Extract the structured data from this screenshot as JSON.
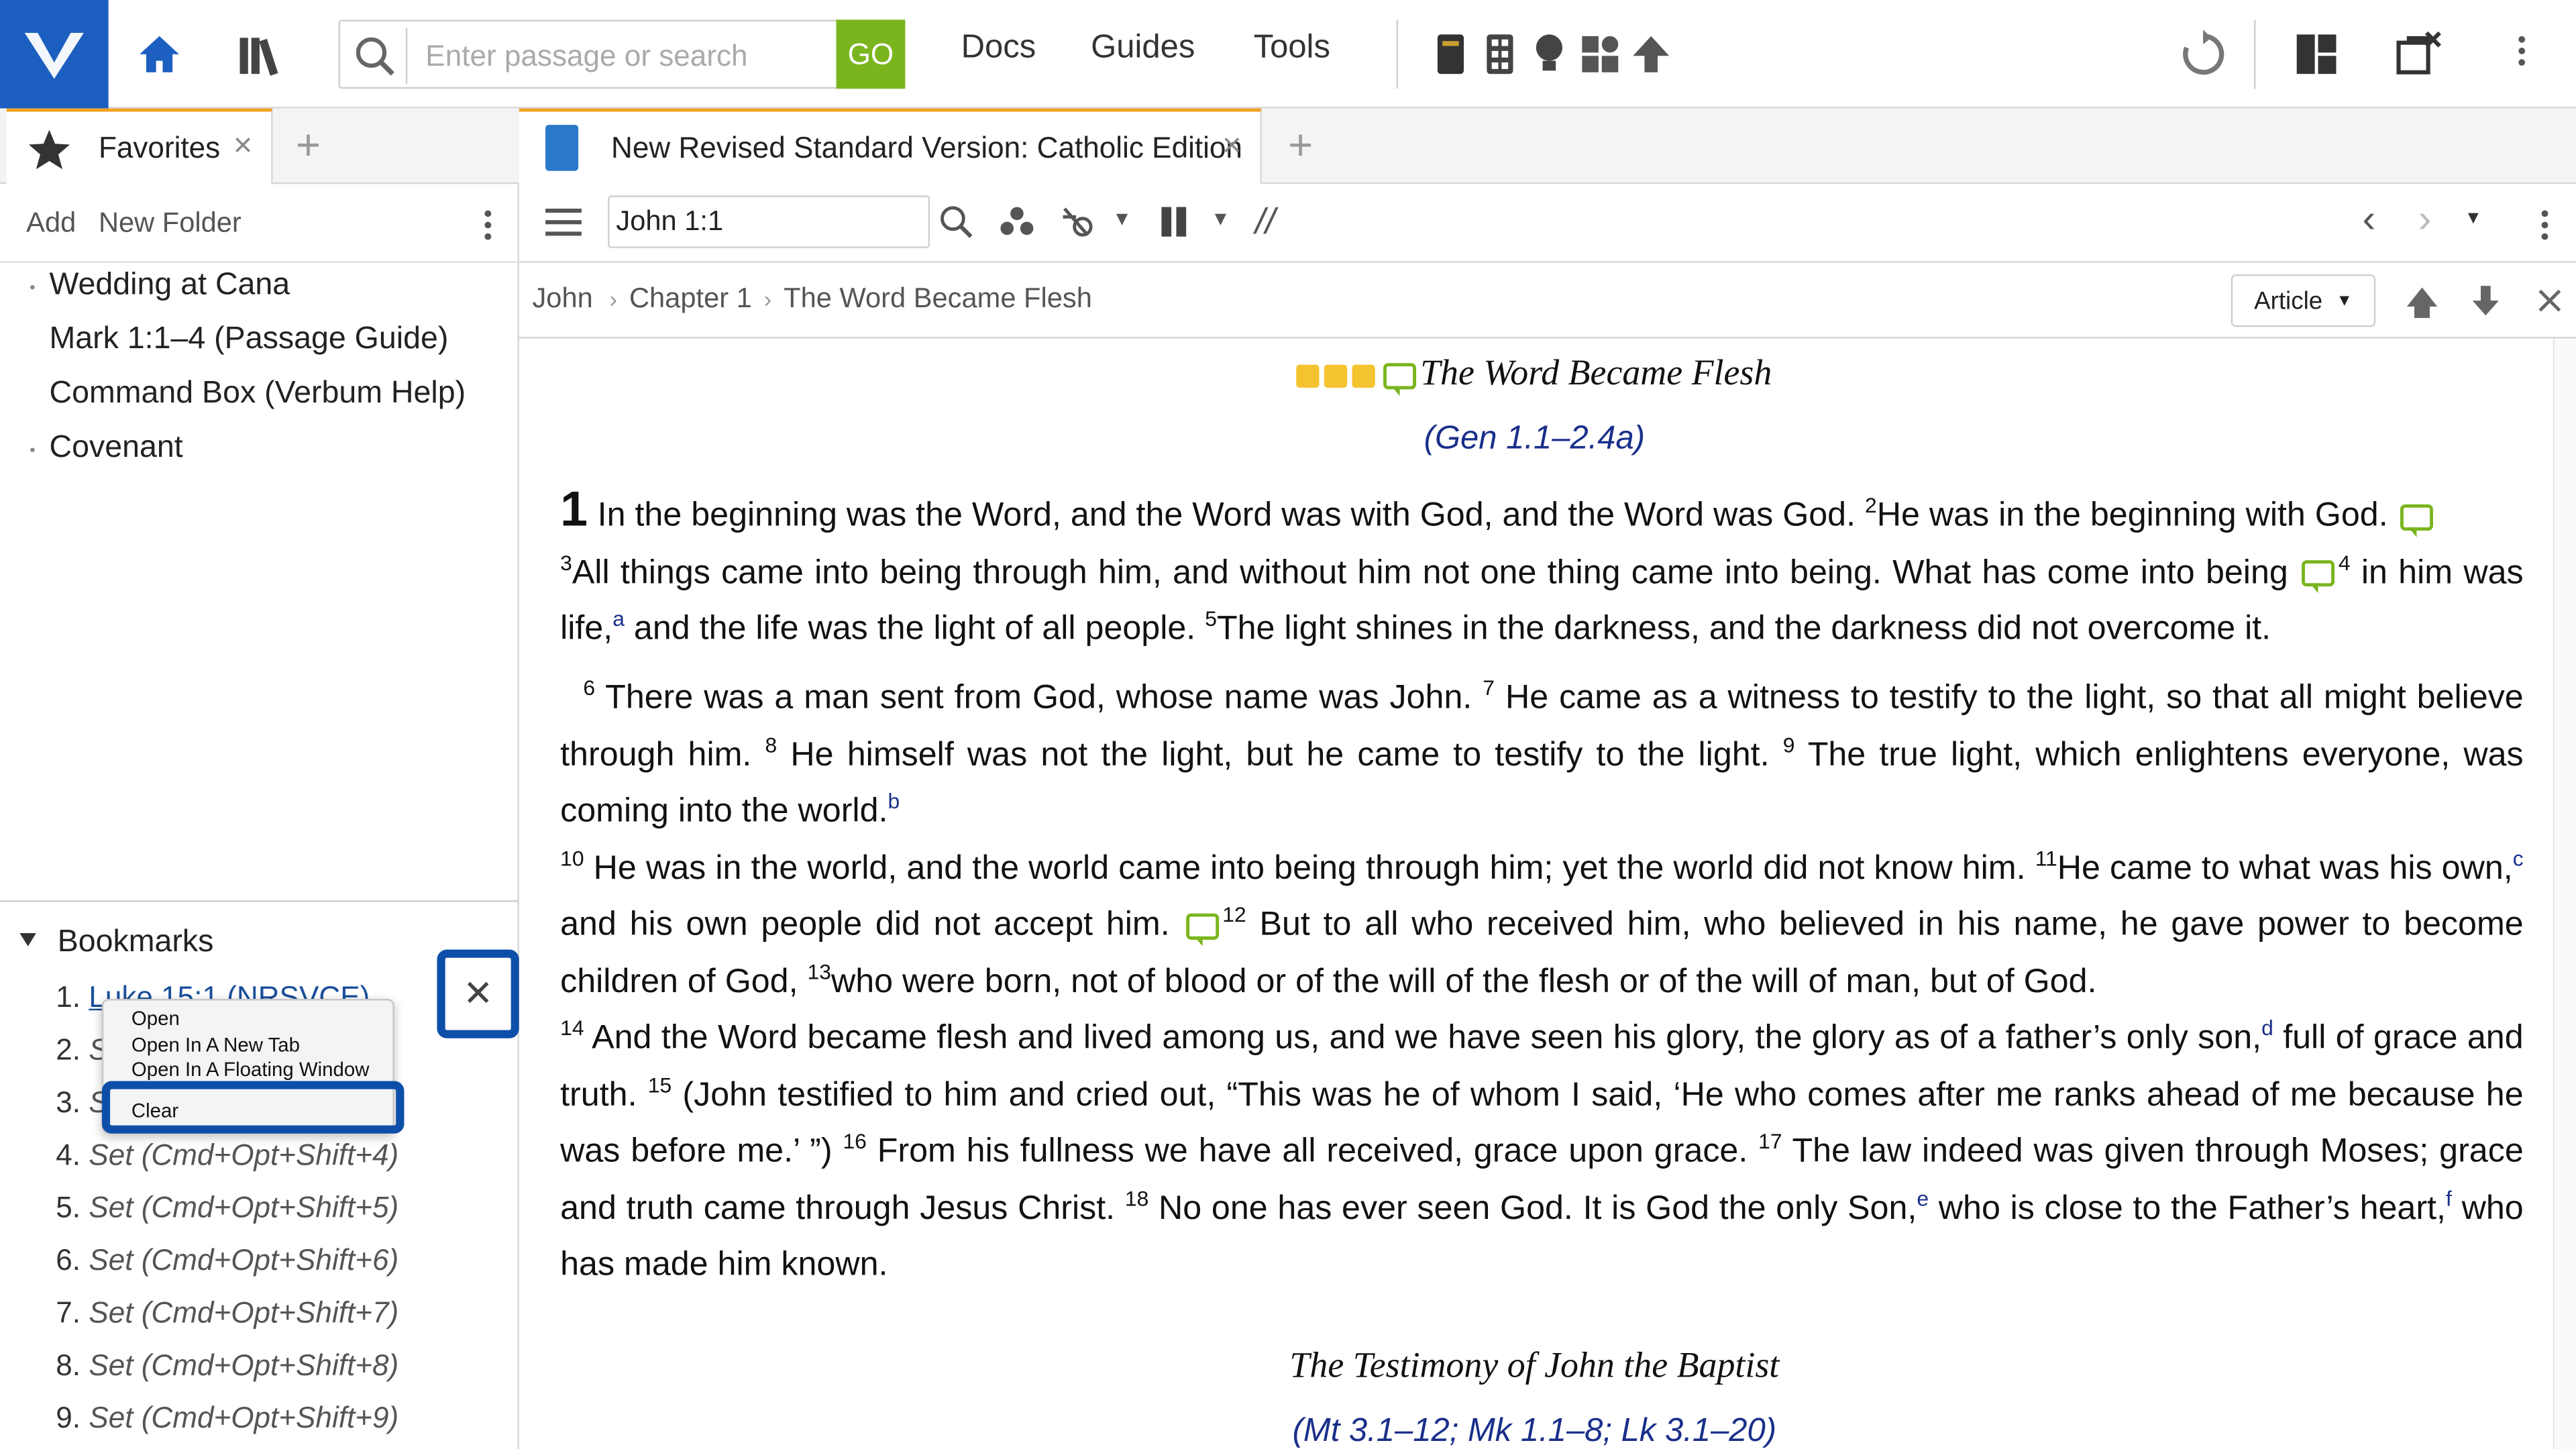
{
  "topbar": {
    "search_placeholder": "Enter passage or search",
    "go_label": "GO",
    "nav": [
      "Docs",
      "Guides",
      "Tools"
    ]
  },
  "left": {
    "tab_label": "Favorites",
    "add_label": "Add",
    "new_folder_label": "New Folder",
    "favorites": [
      "Wedding at Cana",
      "Mark 1:1–4 (Passage Guide)",
      "Command Box (Verbum Help)",
      "Covenant"
    ],
    "bookmarks_title": "Bookmarks",
    "bookmarks": [
      {
        "num": "1.",
        "label": "Luke 15:1 (NRSVCE)"
      },
      {
        "num": "2.",
        "label": "S"
      },
      {
        "num": "3.",
        "label": "S"
      },
      {
        "num": "4.",
        "label": "Set (Cmd+Opt+Shift+4)"
      },
      {
        "num": "5.",
        "label": "Set (Cmd+Opt+Shift+5)"
      },
      {
        "num": "6.",
        "label": "Set (Cmd+Opt+Shift+6)"
      },
      {
        "num": "7.",
        "label": "Set (Cmd+Opt+Shift+7)"
      },
      {
        "num": "8.",
        "label": "Set (Cmd+Opt+Shift+8)"
      },
      {
        "num": "9.",
        "label": "Set (Cmd+Opt+Shift+9)"
      }
    ],
    "context_menu": [
      "Open",
      "Open In A New Tab",
      "Open In A Floating Window",
      "Clear"
    ]
  },
  "right": {
    "tab_label": "New Revised Standard Version: Catholic Edition",
    "reference": "John 1:1",
    "breadcrumb": [
      "John",
      "Chapter 1",
      "The Word Became Flesh"
    ],
    "article_label": "Article",
    "heading1": "The Word Became Flesh",
    "xref1": "(Gen 1.1–2.4a)",
    "heading2": "The Testimony of John the Baptist",
    "xref2": "(Mt 3.1–12; Mk 1.1–8; Lk 3.1–20)",
    "verses": {
      "v1": "In the beginning was the Word, and the Word was with God, and the Word was God.",
      "v2": "He was in the beginning with God.",
      "v3": "All things came into being through him, and without him not one thing came into being. What has come into being",
      "v4": "in him was life,",
      "v4b": "and the life was the light of all people.",
      "v5": "The light shines in the darkness, and the darkness did not overcome it.",
      "v6": "There was a man sent from God, whose name was John.",
      "v7": "He came as a witness to testify to the light, so that all might believe through him.",
      "v8": "He himself was not the light, but he came to testify to the light.",
      "v9": "The true light, which enlightens everyone, was coming into the world.",
      "v10": "He was in the world, and the world came into being through him; yet the world did not know him.",
      "v11": "He came to what was his own,",
      "v11b": "and his own people did not accept him.",
      "v12": "But to all who received him, who believed in his name, he gave power to become children of God,",
      "v13": "who were born, not of blood or of the will of the flesh or of the will of man, but of God.",
      "v14": "And the Word became flesh and lived among us, and we have seen his glory, the glory as of a father’s only son,",
      "v14b": "full of grace and truth.",
      "v15": "(John testified to him and cried out, “This was he of whom I said, ‘He who comes after me ranks ahead of me because he was before me.’ ”)",
      "v16": "From his fullness we have all received, grace upon grace.",
      "v17": "The law indeed was given through Moses; grace and truth came through Jesus Christ.",
      "v18": "No one has ever seen God. It is God the only Son,",
      "v18b": "who is close to the Father’s heart,",
      "v18c": "who has made him known."
    },
    "footnotes": [
      "a",
      "b",
      "c",
      "d",
      "e",
      "f"
    ],
    "verse_numbers": [
      "1",
      "2",
      "3",
      "4",
      "5",
      "6",
      "7",
      "8",
      "9",
      "10",
      "11",
      "12",
      "13",
      "14",
      "15",
      "16",
      "17",
      "18"
    ]
  },
  "colors": {
    "brand": "#1c5fc0",
    "go": "#7ab51d",
    "highlight_outline": "#0d4fa8",
    "tab_accent": "#f0a020"
  }
}
